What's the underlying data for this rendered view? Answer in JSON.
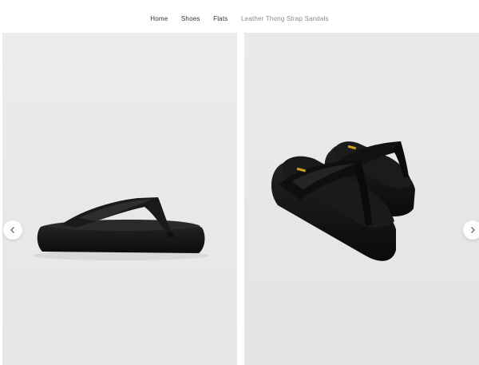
{
  "breadcrumb": {
    "home": "Home",
    "shoes": "Shoes",
    "flats": "Flats",
    "current": "Leather Thong Strap Sandals",
    "separator": "·"
  },
  "gallery": {
    "images": [
      {
        "alt": "Leather Thong Strap Sandals side view",
        "icon": "sandal-side-image"
      },
      {
        "alt": "Leather Thong Strap Sandals pair view",
        "icon": "sandal-pair-image"
      }
    ],
    "prev_icon": "chevron-left-icon",
    "next_icon": "chevron-right-icon"
  },
  "colors": {
    "sandal": "#141414",
    "background": "#e8e8e8",
    "insole_logo": "#c9a227"
  }
}
